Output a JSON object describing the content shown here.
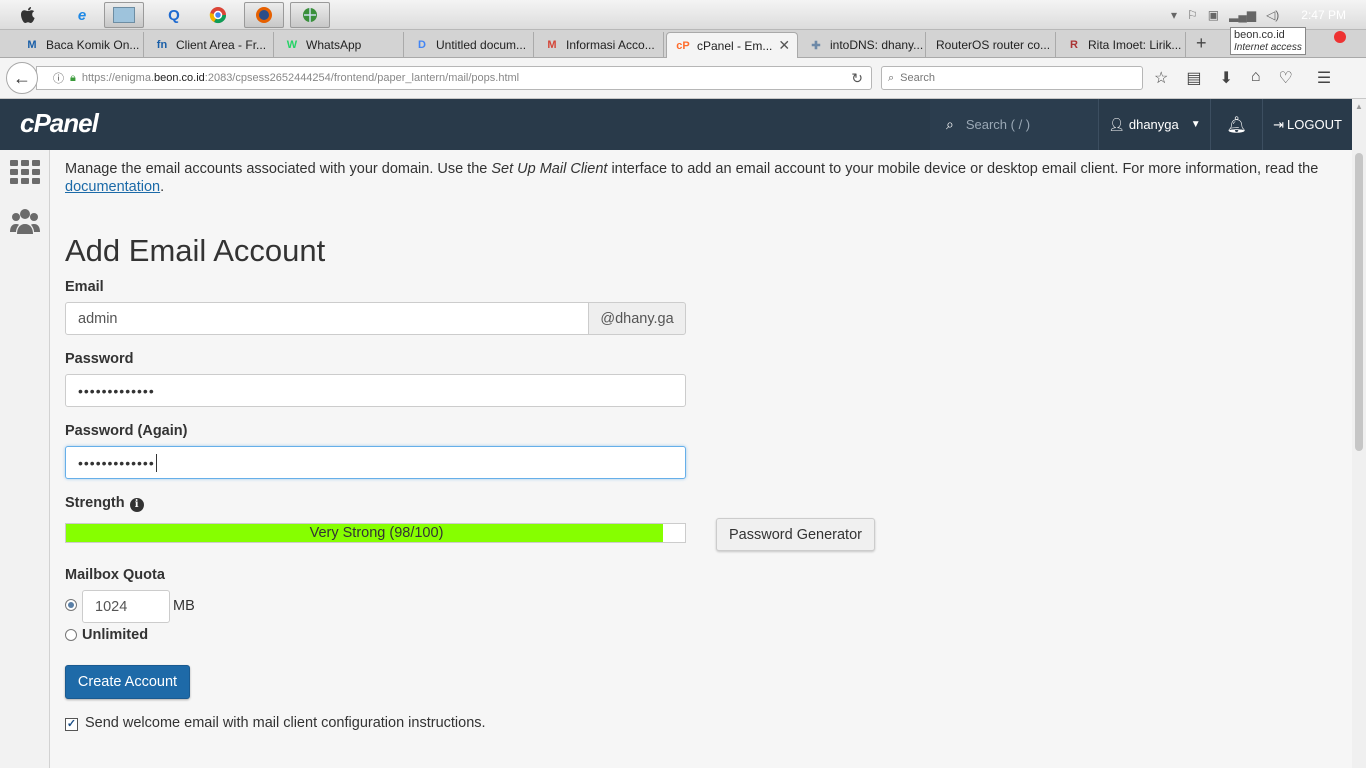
{
  "os": {
    "clock": "2:47 PM"
  },
  "tabs": [
    {
      "label": "Baca Komik On...",
      "icon": "M",
      "color": "#1a5fa8"
    },
    {
      "label": "Client Area - Fr...",
      "icon": "fn",
      "color": "#1a5fa8"
    },
    {
      "label": "WhatsApp",
      "icon": "W",
      "color": "#25d366"
    },
    {
      "label": "Untitled docum...",
      "icon": "D",
      "color": "#4285f4"
    },
    {
      "label": "Informasi Acco...",
      "icon": "M",
      "color": "#d44638"
    },
    {
      "label": "cPanel - Em...",
      "icon": "cP",
      "color": "#ff6c2c"
    },
    {
      "label": "intoDNS: dhany...",
      "icon": "✚",
      "color": "#6d89a8"
    },
    {
      "label": "RouterOS router co...",
      "icon": "",
      "color": "#999"
    },
    {
      "label": "Rita Imoet: Lirik...",
      "icon": "R",
      "color": "#a33"
    }
  ],
  "tooltip": {
    "title": "beon.co.id",
    "subtitle": "Internet access"
  },
  "nav": {
    "url_prefix": "https://enigma.",
    "url_host": "beon.co.id",
    "url_suffix": ":2083/cpsess2652444254/frontend/paper_lantern/mail/pops.html",
    "search_placeholder": "Search"
  },
  "cpanel": {
    "logo": "cPanel",
    "search_placeholder": "Search ( / )",
    "username": "dhanyga",
    "logout": "LOGOUT"
  },
  "page": {
    "intro_a": "Manage the email accounts associated with your domain. Use the ",
    "intro_em": "Set Up Mail Client",
    "intro_b": " interface to add an email account to your mobile device or desktop email client. For more information, read the ",
    "intro_link": "documentation",
    "intro_end": ".",
    "title": "Add Email Account",
    "email_label": "Email",
    "email_value": "admin",
    "domain_addon": "@dhany.ga",
    "password_label": "Password",
    "password_value": "•••••••••••••",
    "password_again_label": "Password (Again)",
    "password_again_value": "•••••••••••••",
    "strength_label": "Strength",
    "strength_text": "Very Strong (98/100)",
    "strength_score": 98,
    "strength_color": "#86ff00",
    "password_generator": "Password Generator",
    "quota_label": "Mailbox Quota",
    "quota_value": "1024",
    "quota_unit": "MB",
    "quota_selected": "limited",
    "unlimited_label": "Unlimited",
    "create_button": "Create Account",
    "welcome_email_label": "Send welcome email with mail client configuration instructions.",
    "welcome_email_checked": true
  }
}
